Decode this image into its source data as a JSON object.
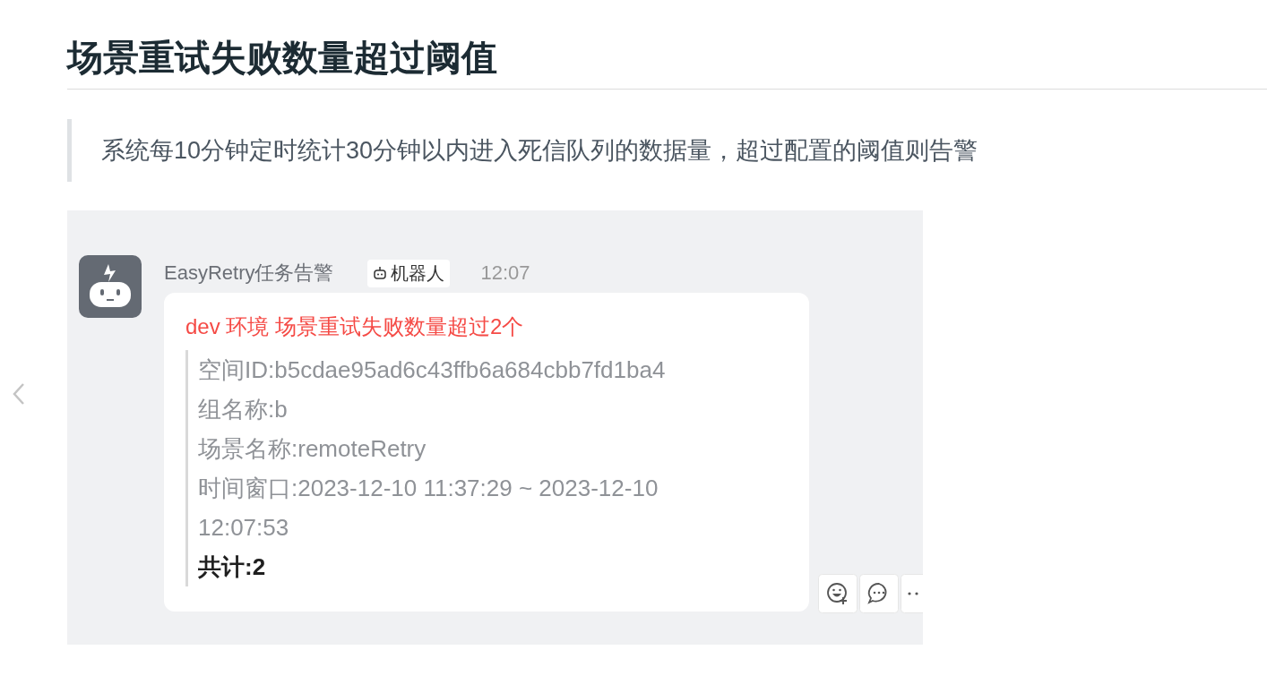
{
  "heading": "场景重试失败数量超过阈值",
  "note": "系统每10分钟定时统计30分钟以内进入死信队列的数据量，超过配置的阈值则告警",
  "screenshot": {
    "sender": "EasyRetry任务告警",
    "badge": "机器人",
    "time": "12:07",
    "message": {
      "title": "dev 环境 场景重试失败数量超过2个",
      "lines": [
        "空间ID:b5cdae95ad6c43ffb6a684cbb7fd1ba4",
        "组名称:b",
        "场景名称:remoteRetry",
        "时间窗口:2023-12-10 11:37:29 ~ 2023-12-10 12:07:53"
      ],
      "total": "共计:2"
    }
  }
}
